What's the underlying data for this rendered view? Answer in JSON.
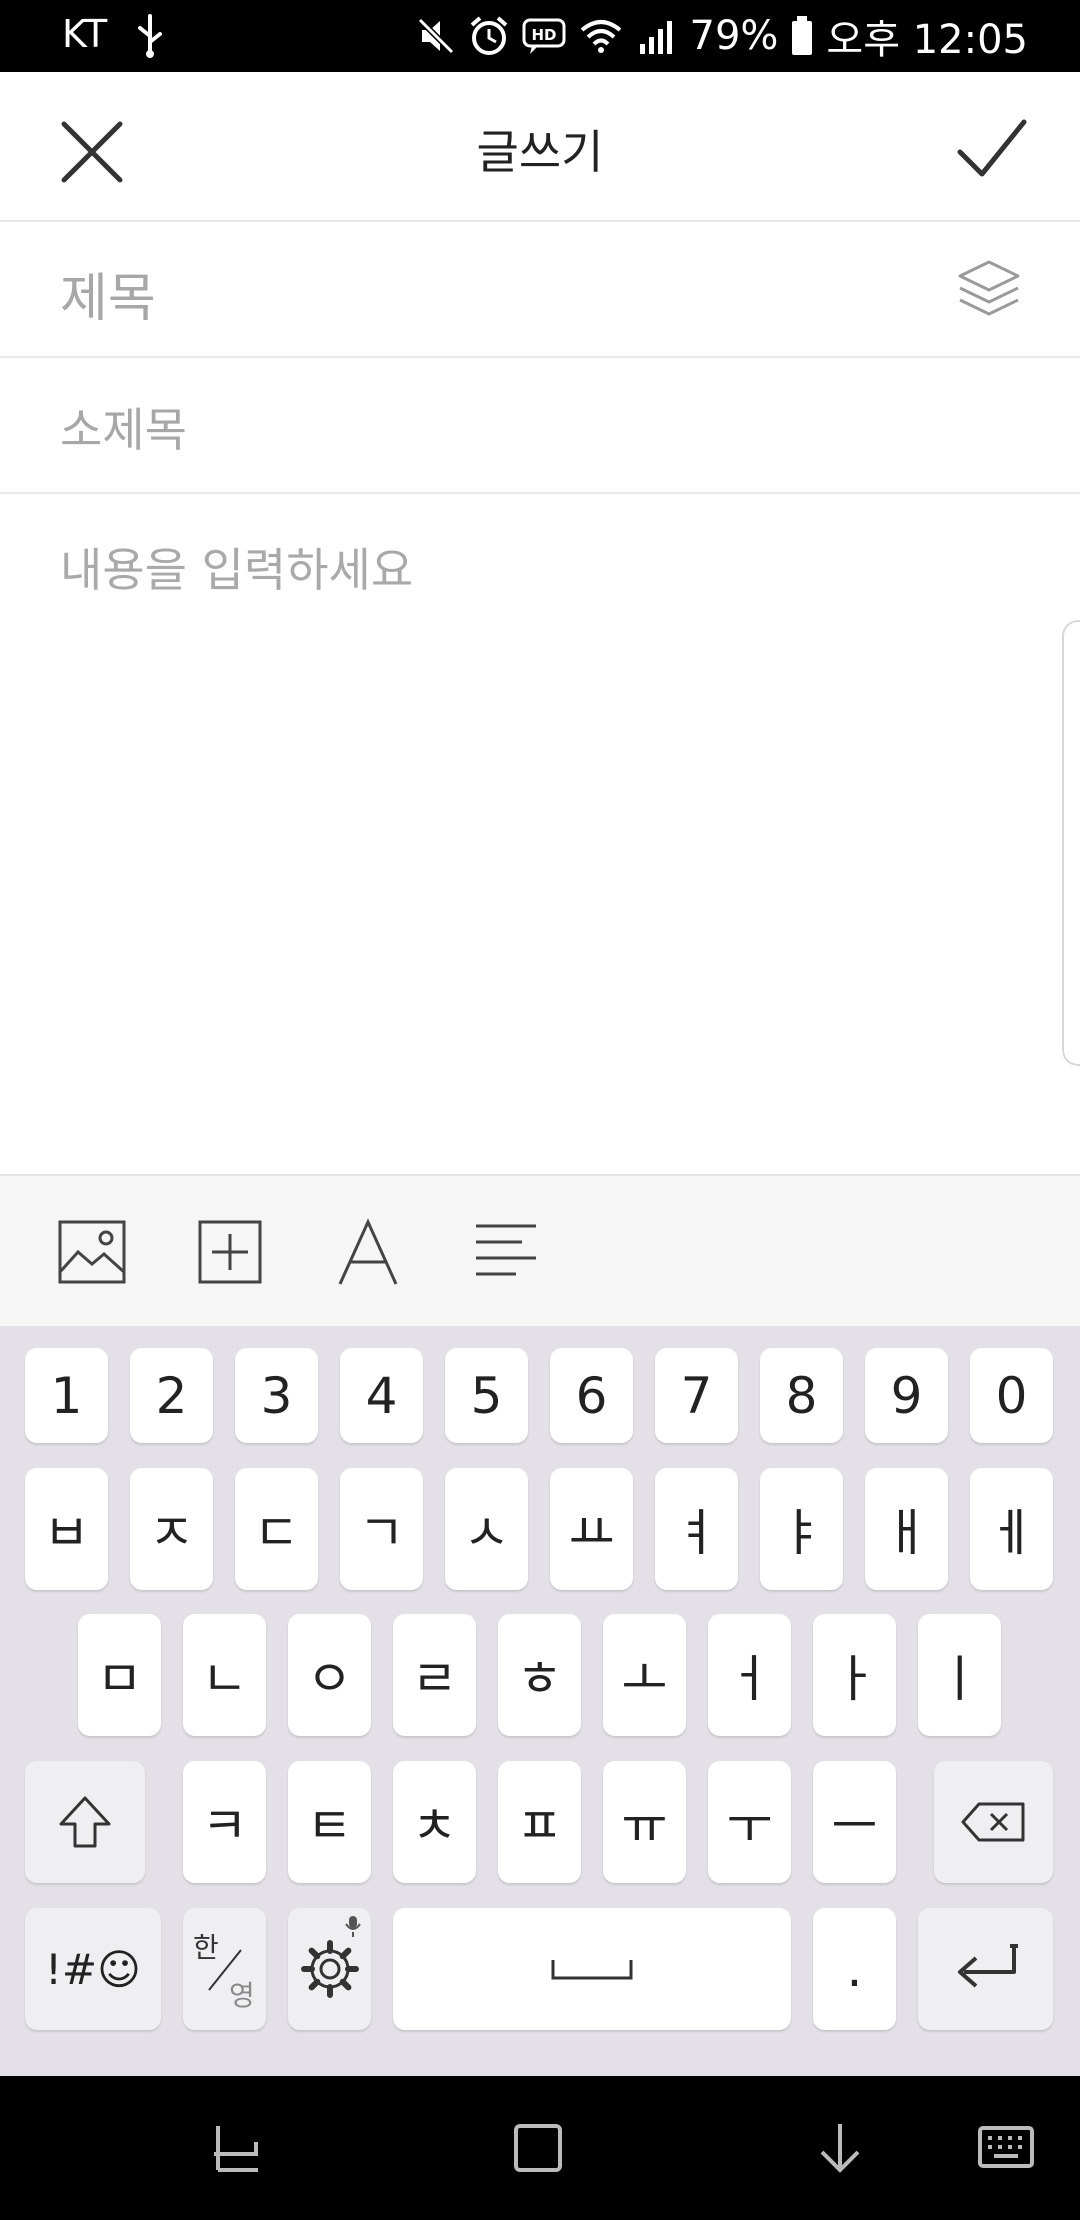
{
  "status_bar": {
    "carrier": "KT",
    "battery_percent": "79%",
    "time": "오후 12:05",
    "icons": [
      "usb-icon",
      "mute-icon",
      "alarm-icon",
      "hd-icon",
      "wifi-icon",
      "signal-icon",
      "battery-icon"
    ]
  },
  "app_bar": {
    "title": "글쓰기",
    "close_icon": "close-icon",
    "confirm_icon": "check-icon"
  },
  "editor": {
    "title_placeholder": "제목",
    "subtitle_placeholder": "소제목",
    "content_placeholder": "내용을 입력하세요",
    "layers_icon": "layers-icon"
  },
  "format_toolbar": {
    "icons": [
      "image-icon",
      "add-box-icon",
      "font-icon",
      "align-left-icon"
    ]
  },
  "keyboard": {
    "row1": [
      "1",
      "2",
      "3",
      "4",
      "5",
      "6",
      "7",
      "8",
      "9",
      "0"
    ],
    "row2": [
      "ㅂ",
      "ㅈ",
      "ㄷ",
      "ㄱ",
      "ㅅ",
      "ㅛ",
      "ㅕ",
      "ㅑ",
      "ㅐ",
      "ㅔ"
    ],
    "row3": [
      "ㅁ",
      "ㄴ",
      "ㅇ",
      "ㄹ",
      "ㅎ",
      "ㅗ",
      "ㅓ",
      "ㅏ",
      "ㅣ"
    ],
    "row4": [
      "ㅋ",
      "ㅌ",
      "ㅊ",
      "ㅍ",
      "ㅠ",
      "ㅜ",
      "ㅡ"
    ],
    "symbols_label": "!#☺",
    "lang_top": "한",
    "lang_bottom": "영",
    "period": "."
  },
  "nav_bar": {
    "icons": [
      "recents-icon",
      "home-icon",
      "hide-keyboard-icon",
      "keyboard-switch-icon"
    ]
  }
}
